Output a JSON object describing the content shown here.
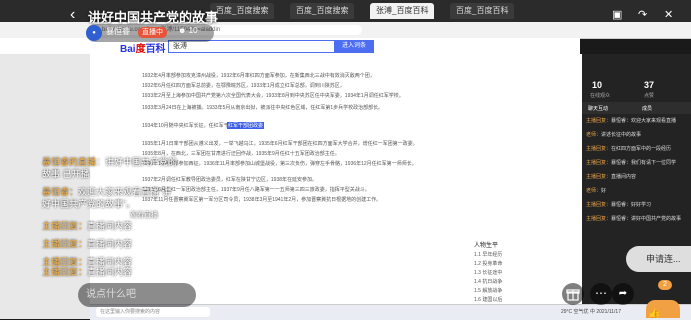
{
  "stream": {
    "title": "讲好中国共产党的故事",
    "host_name": "暴恒睿",
    "live_label": "直播中",
    "viewer_count": "10",
    "back_icon": "back-arrow-icon"
  },
  "browser": {
    "tabs": [
      "百度_百度搜索",
      "百度_百度搜索",
      "张溥_百度百科",
      "百度_百度百科"
    ],
    "url": "baike.baidu.com/item/张溥/11504?fr=aladdin",
    "search_value": "张溥",
    "search_button": "进入词条"
  },
  "document": {
    "lines": [
      "1932年4月率部参加攻克漳州战役，1932年6月率红四方面军参加，在新集西北三战中有效消灭敌两个团，",
      "1932年6月任红四方面军总前委，在鄂豫皖苏区，1933年1月成立红军总部，调到川陕苏区，",
      "1933年2月至上海参加中国共产党第六次全国代表大会，1933年8月到中央苏区任中央军委，1934年1月调任红军学校。",
      "1933年3月24日在上海被捕。1933年5月从南京出狱，被派往中央红色区域，任红军第1步兵学校政治部部长。",
      "1934年10月随中央红军长征，任红军干部团政委",
      "1935年1月1日率干部团从遵义出发，一举飞越乌江，1935年6月红军干部团在红四方面军大学合并，增任红一军团第一政委。",
      "1935年8月，在西北，三军团在甘肃进行迂回作战，1935年9月任红十五军团政治部主任。",
      "1936年10月率部参加西征，1936年11月率部参加山城堡战役，第三次负伤，弹穿左手骨骼，1936年12月任红军第一师师长。",
      "1937年2月调任红军教导团政治委员，红军在陕甘宁边区，1938年在延安参加。",
      "1937年6月任红一军团政治部主任，1937年9月任八路军第一一五师第三四三旅政委，指挥平型关战斗。",
      "1937年11月任晋察冀军区第一军分区司令员，1938年3月至1941年2月，参加晋察冀抗日根据地的创建工作。"
    ],
    "highlight": "红军干部团政委",
    "toc": {
      "title": "人物生平",
      "items": [
        "1.1 早年经历",
        "1.2 投身革命",
        "1.3 长征途中",
        "1.4 抗日战争",
        "1.5 解放战争",
        "1.6 建国以后"
      ]
    }
  },
  "right_panel": {
    "stat1_value": "10",
    "stat1_label": "在线观众",
    "stat2_value": "37",
    "stat2_label": "点赞",
    "tab_chat": "聊天互动",
    "tab_members": "成员",
    "messages": [
      {
        "nick": "主播回复：",
        "text": "暴恒睿：欢迎大家来观看直播"
      },
      {
        "nick": "老师：",
        "text": "讲述长征中的故事"
      },
      {
        "nick": "主播回复：",
        "text": "在红四方面军中的一段经历"
      },
      {
        "nick": "主播回复：",
        "text": "暴恒睿：我们有请下一位同学"
      },
      {
        "nick": "主播回复：",
        "text": "直播间内容"
      },
      {
        "nick": "老师：",
        "text": "好"
      },
      {
        "nick": "主播回复：",
        "text": "暴恒睿：好好学习"
      },
      {
        "nick": "主播回复：",
        "text": "暴恒睿：讲好中国共产党的故事"
      }
    ]
  },
  "chat_overlay": [
    {
      "nick": "暴恒睿的直播",
      "text": "：讲好中国共产党的"
    },
    {
      "nick": "",
      "text": "故事 已开播"
    },
    {
      "nick": "暴恒睿：",
      "text": "欢迎大家来观看直播“讲"
    },
    {
      "nick": "",
      "text": "好中国共产党的故事”。"
    },
    {
      "nick": "",
      "text": "观看直播"
    },
    {
      "nick": "主播回复：",
      "text": "直播间内容"
    },
    {
      "nick": "主播回复：",
      "text": "直播间内容"
    },
    {
      "nick": "主播回复：",
      "text": "直播间内容"
    },
    {
      "nick": "主播回复：",
      "text": "直播间内容"
    }
  ],
  "bottom": {
    "input_placeholder": "说点什么吧",
    "apply_mic": "申请连...",
    "like_count": "2",
    "taskbar_search": "在这里输入你要搜索的内容",
    "taskbar_info": "29°C 空气优 中 2021/11/17"
  }
}
